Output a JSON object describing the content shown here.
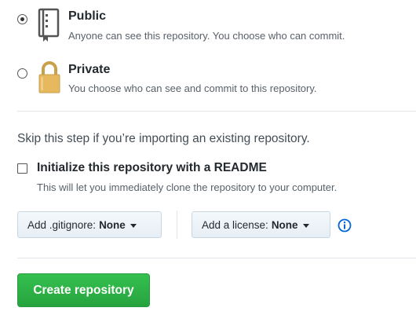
{
  "visibility": {
    "public": {
      "title": "Public",
      "description": "Anyone can see this repository. You choose who can commit.",
      "selected": true,
      "icon": "repo-book-icon"
    },
    "private": {
      "title": "Private",
      "description": "You choose who can see and commit to this repository.",
      "selected": false,
      "icon": "lock-icon"
    }
  },
  "import_hint": "Skip this step if you’re importing an existing repository.",
  "readme": {
    "title": "Initialize this repository with a README",
    "description": "This will let you immediately clone the repository to your computer.",
    "checked": false
  },
  "gitignore": {
    "label": "Add .gitignore:",
    "value": "None"
  },
  "license": {
    "label": "Add a license:",
    "value": "None"
  },
  "info_icon": "info-icon",
  "create_button": "Create repository",
  "colors": {
    "primary_green": "#2ea44f",
    "link_blue": "#0366d6"
  }
}
